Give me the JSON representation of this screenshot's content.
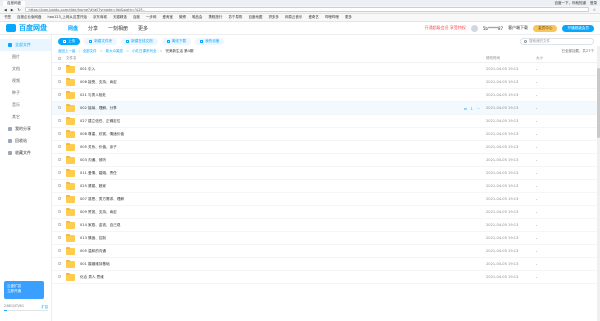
{
  "browser": {
    "tab_label": "百度网盘",
    "url": "https://pan.baidu.com/disk/home?#/all?vmode=list&path=%2F...",
    "right_items": [
      "百度一下，你就知道",
      "登录"
    ],
    "bookmarks": [
      "书签",
      "百度企业版网盘",
      "hao123_上网从这里开始",
      "京东商城",
      "天猫精选",
      "百度",
      "一步网",
      "爱淘宝",
      "微博",
      "唯品会",
      "携程旅行",
      "苏宁易购",
      "百度地图",
      "拼多多",
      "网易云音乐",
      "爱奇艺",
      "哔哩哔哩",
      "更多"
    ]
  },
  "app": {
    "logo": "百度网盘",
    "tabs": [
      {
        "label": "网盘",
        "active": true
      },
      {
        "label": "分享"
      },
      {
        "label": "一刻相册"
      },
      {
        "label": "更多"
      }
    ],
    "header_link": "开通超级会员 享受特权",
    "username": "5b*****87",
    "header_buttons": [
      "客户端下载",
      "会员中心",
      "开通超级会员"
    ]
  },
  "sidebar": {
    "items": [
      {
        "label": "全部文件",
        "active": true
      },
      {
        "label": "图片",
        "sub": true
      },
      {
        "label": "文档",
        "sub": true
      },
      {
        "label": "视频",
        "sub": true
      },
      {
        "label": "种子",
        "sub": true
      },
      {
        "label": "音乐",
        "sub": true
      },
      {
        "label": "其它",
        "sub": true
      },
      {
        "label": "我的分享"
      },
      {
        "label": "回收站"
      },
      {
        "label": "收藏文件"
      }
    ],
    "banner_title": "云盘扩容",
    "banner_sub": "立即开通",
    "storage_text": "238G/5T/9G",
    "storage_action": "扩容",
    "storage_fill": 0.07
  },
  "toolbar": {
    "buttons": [
      {
        "label": "上传",
        "primary": true
      },
      {
        "label": "新建文件夹"
      },
      {
        "label": "新建在线文档"
      },
      {
        "label": "离线下载"
      },
      {
        "label": "我的设备"
      }
    ],
    "search_placeholder": "搜索我的文件"
  },
  "breadcrumbs": [
    "返回上一级",
    "全部文件",
    "新大众婚恋",
    "小红日课系列全",
    "完美新生活 第4期"
  ],
  "count_text": "已全部加载，共27个",
  "columns": {
    "name": "文件名",
    "time": "修改时间",
    "size": "大小"
  },
  "rows": [
    {
      "name": "001 引入",
      "time": "2021-04-05 19:13"
    },
    {
      "name": "006 接受、支持、肯定",
      "time": "2021-04-05 19:13"
    },
    {
      "name": "021 与男人相处",
      "time": "2021-04-05 19:13"
    },
    {
      "name": "002 接纳、理解、分享",
      "time": "2021-04-05 19:13",
      "hover": true
    },
    {
      "name": "027 建立信任、正确定位",
      "time": "2021-04-05 19:13"
    },
    {
      "name": "008 尊重、欣赏、情绪价值",
      "time": "2021-04-05 19:13"
    },
    {
      "name": "005 关系、价值、亲子",
      "time": "2021-04-05 19:13"
    },
    {
      "name": "003 沟通、倾听",
      "time": "2021-04-05 19:13"
    },
    {
      "name": "011 爱情、婚姻、责任",
      "time": "2021-04-05 19:13"
    },
    {
      "name": "025 婆媳、娘家",
      "time": "2021-04-05 19:13"
    },
    {
      "name": "007 感恩、男方需求、理解",
      "time": "2021-04-05 19:13"
    },
    {
      "name": "009 赞赏、支持、肯定",
      "time": "2021-04-05 19:13"
    },
    {
      "name": "014 家庭、金钱、自己观",
      "time": "2021-04-05 19:13"
    },
    {
      "name": "013 情绪、控制",
      "time": "2021-04-05 19:13"
    },
    {
      "name": "005 温和的沟通",
      "time": "2021-04-05 19:13"
    },
    {
      "name": "001 婚姻维持基础",
      "time": "2021-04-05 19:13"
    },
    {
      "name": "化合 男人 思维",
      "time": "2021-04-05 19:13"
    }
  ]
}
